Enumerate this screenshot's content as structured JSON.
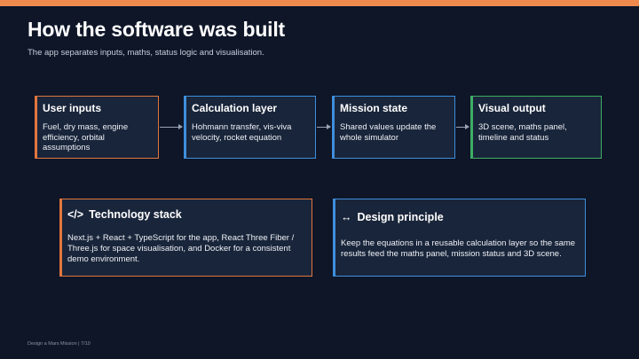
{
  "slide": {
    "title": "How the software was built",
    "subtitle": "The app separates inputs, maths, status logic and visualisation."
  },
  "flow": [
    {
      "title": "User inputs",
      "body": "Fuel, dry mass, engine efficiency, orbital assumptions"
    },
    {
      "title": "Calculation layer",
      "body": "Hohmann transfer, vis-viva velocity, rocket equation"
    },
    {
      "title": "Mission state",
      "body": "Shared values update the whole simulator"
    },
    {
      "title": "Visual output",
      "body": "3D scene, maths panel, timeline and status"
    }
  ],
  "tech": {
    "icon": "</>",
    "title": "Technology stack",
    "body": "Next.js + React + TypeScript for the app, React Three Fiber / Three.js for space visualisation, and Docker for a consistent demo environment."
  },
  "design": {
    "icon": "↔",
    "title": "Design principle",
    "body": "Keep the equations in a reusable calculation layer so the same results feed the maths panel, mission status and 3D scene."
  },
  "footer": {
    "text": "Design a Mars Mission  |  7/10"
  },
  "colors": {
    "accent_orange": "#ef8a4f",
    "blue": "#3f8fdc",
    "green": "#3fae64",
    "background": "#0e1628"
  }
}
